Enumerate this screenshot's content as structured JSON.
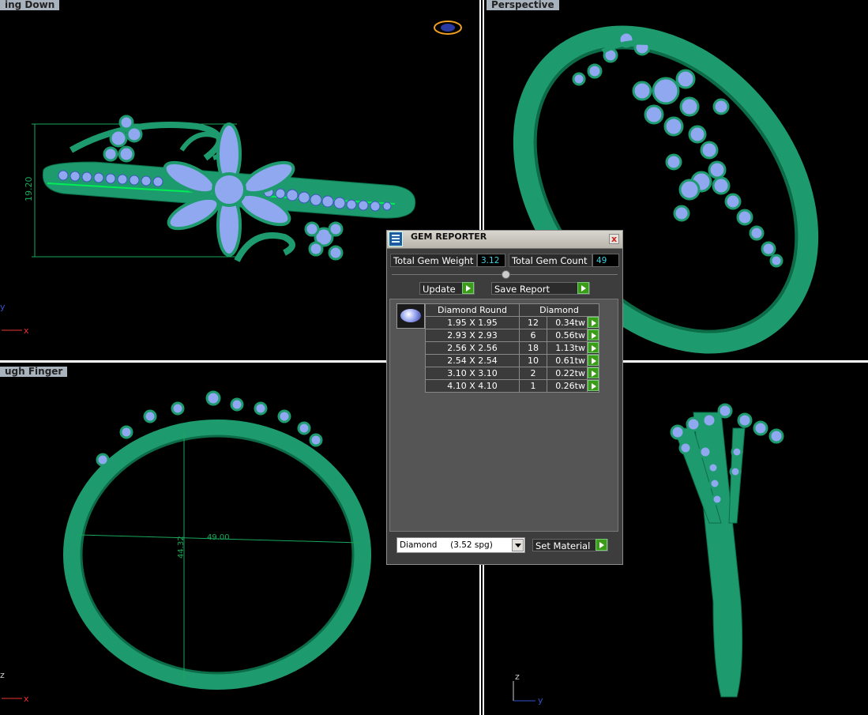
{
  "viewports": {
    "top_left_label": "ing Down",
    "top_right_label": "Perspective",
    "bottom_left_label": "ugh Finger",
    "dimension_height": "19.20",
    "dimension_width": "49.00",
    "dimension_inner": "44.32"
  },
  "axes": {
    "x": "x",
    "y": "y",
    "z": "z"
  },
  "gem_reporter": {
    "title": "GEM REPORTER",
    "close_label": "x",
    "total_weight_label": "Total Gem Weight",
    "total_weight_value": "3.12",
    "total_count_label": "Total Gem Count",
    "total_count_value": "49",
    "update_label": "Update",
    "save_report_label": "Save Report",
    "columns": [
      "Diamond Round",
      "Diamond"
    ],
    "rows": [
      {
        "size": "1.95 X 1.95",
        "count": "12",
        "tw": "0.34tw"
      },
      {
        "size": "2.93 X 2.93",
        "count": "6",
        "tw": "0.56tw"
      },
      {
        "size": "2.56 X 2.56",
        "count": "18",
        "tw": "1.13tw"
      },
      {
        "size": "2.54 X 2.54",
        "count": "10",
        "tw": "0.61tw"
      },
      {
        "size": "3.10 X 3.10",
        "count": "2",
        "tw": "0.22tw"
      },
      {
        "size": "4.10 X 4.10",
        "count": "1",
        "tw": "0.26tw"
      }
    ],
    "material_select": "Diamond     (3.52 spg)",
    "set_material_label": "Set Material"
  },
  "colors": {
    "metal": "#1e9b6e",
    "gem": "#8fa8f0",
    "dimension": "#19a85a",
    "panel": "#3d3d3d"
  }
}
